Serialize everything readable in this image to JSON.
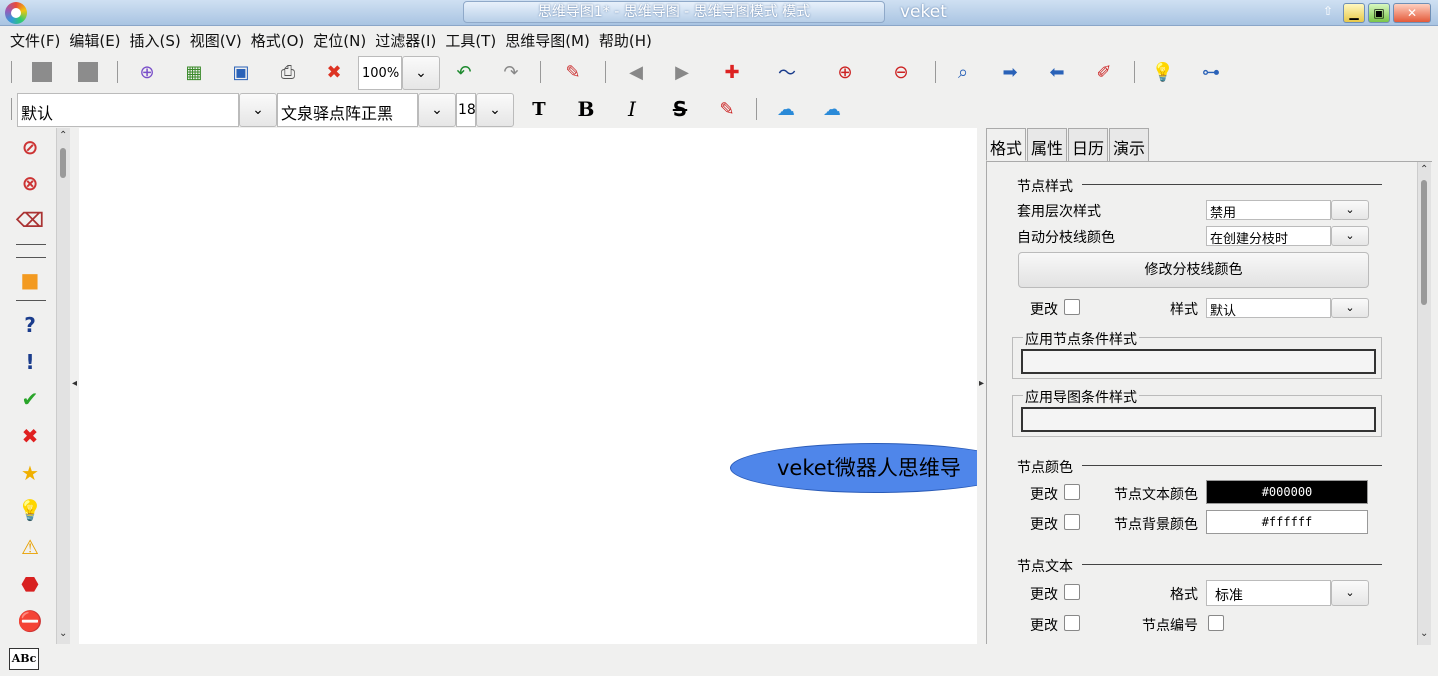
{
  "window": {
    "title": "思维导图1* - 思维导图 - 思维导图模式 模式",
    "extra_title": "veket"
  },
  "menu": [
    "文件(F)",
    "编辑(E)",
    "插入(S)",
    "视图(V)",
    "格式(O)",
    "定位(N)",
    "过滤器(I)",
    "工具(T)",
    "思维导图(M)",
    "帮助(H)"
  ],
  "toolbar": {
    "zoom": "100%",
    "style_select": "默认",
    "font_family": "文泉驿点阵正黑",
    "font_size": "18",
    "bold": "B",
    "italic": "I",
    "strike": "S"
  },
  "map": {
    "root_node": "veket微器人思维导"
  },
  "panel": {
    "tabs": [
      "格式",
      "属性",
      "日历",
      "演示"
    ],
    "node_style": {
      "section": "节点样式",
      "level_style_label": "套用层次样式",
      "level_style_value": "禁用",
      "auto_branch_label": "自动分枝线颜色",
      "auto_branch_value": "在创建分枝时",
      "modify_branch_button": "修改分枝线颜色",
      "change_label": "更改",
      "style_label": "样式",
      "style_value": "默认",
      "node_cond_group": "应用节点条件样式",
      "map_cond_group": "应用导图条件样式"
    },
    "node_color": {
      "section": "节点颜色",
      "change_label_1": "更改",
      "text_color_label": "节点文本颜色",
      "text_color_value": "#000000",
      "change_label_2": "更改",
      "bg_color_label": "节点背景颜色",
      "bg_color_value": "#ffffff"
    },
    "node_text": {
      "section": "节点文本",
      "change_label_1": "更改",
      "format_label": "格式",
      "format_value": "标准",
      "change_label_2": "更改",
      "numbering_label": "节点编号"
    }
  },
  "status": {
    "spell_icon_text": "ABc"
  },
  "colors": {
    "root_node_fill": "#4f86ea",
    "text_color_swatch": "#000000",
    "bg_color_swatch": "#ffffff"
  }
}
